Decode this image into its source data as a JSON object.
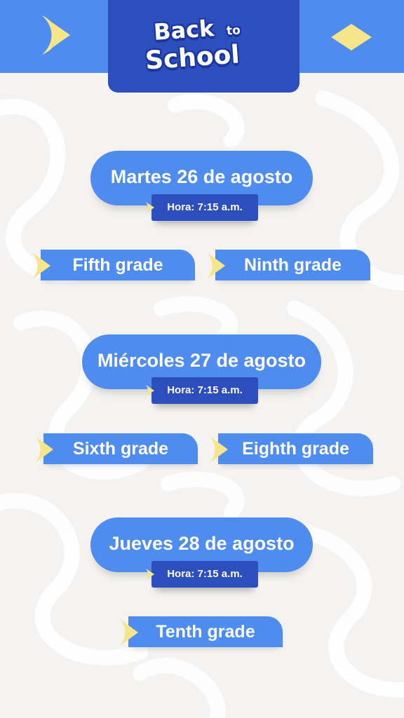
{
  "header": {
    "logo_line1": "Back",
    "logo_line1_small": "to",
    "logo_line2": "School",
    "icons": {
      "left": "crescent-moon-icon",
      "right": "diamond-icon"
    }
  },
  "schedule": [
    {
      "date": "Martes 26 de agosto",
      "time": "Hora: 7:15 a.m.",
      "grades": [
        "Fifth grade",
        "Ninth grade"
      ]
    },
    {
      "date": "Miércoles 27 de agosto",
      "time": "Hora: 7:15 a.m.",
      "grades": [
        "Sixth grade",
        "Eighth grade"
      ]
    },
    {
      "date": "Jueves 28 de agosto",
      "time": "Hora: 7:15 a.m.",
      "grades": [
        "Tenth grade"
      ]
    }
  ],
  "colors": {
    "background": "#f4f3f1",
    "primary_blue": "#4f8cf0",
    "dark_blue": "#2d4fbe",
    "accent_yellow": "#f7e58a"
  }
}
